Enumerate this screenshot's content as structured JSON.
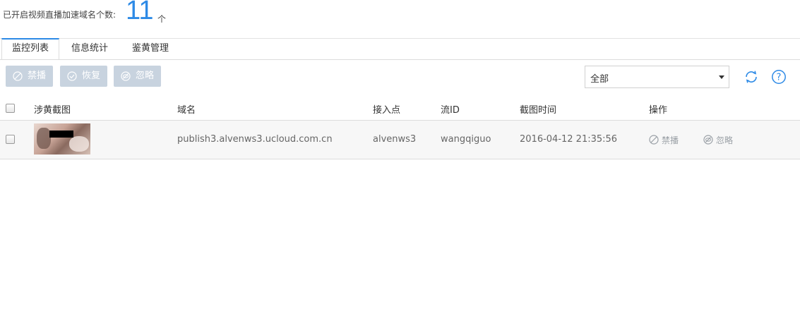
{
  "header": {
    "stat_label": "已开启视频直播加速域名个数:",
    "stat_count": "11",
    "stat_unit": "个"
  },
  "tabs": [
    {
      "label": "监控列表",
      "active": true
    },
    {
      "label": "信息统计",
      "active": false
    },
    {
      "label": "鉴黄管理",
      "active": false
    }
  ],
  "toolbar": {
    "ban_label": "禁播",
    "restore_label": "恢复",
    "ignore_label": "忽略",
    "filter_value": "全部",
    "button_color": "#c8d3df",
    "accent_color": "#2d8ae6"
  },
  "table": {
    "columns": [
      "涉黄截图",
      "域名",
      "接入点",
      "流ID",
      "截图时间",
      "操作"
    ],
    "rows": [
      {
        "domain": "publish3.alvenws3.ucloud.com.cn",
        "access_point": "alvenws3",
        "stream_id": "wangqiguo",
        "time": "2016-04-12 21:35:56",
        "actions": [
          "禁播",
          "忽略"
        ]
      }
    ]
  }
}
